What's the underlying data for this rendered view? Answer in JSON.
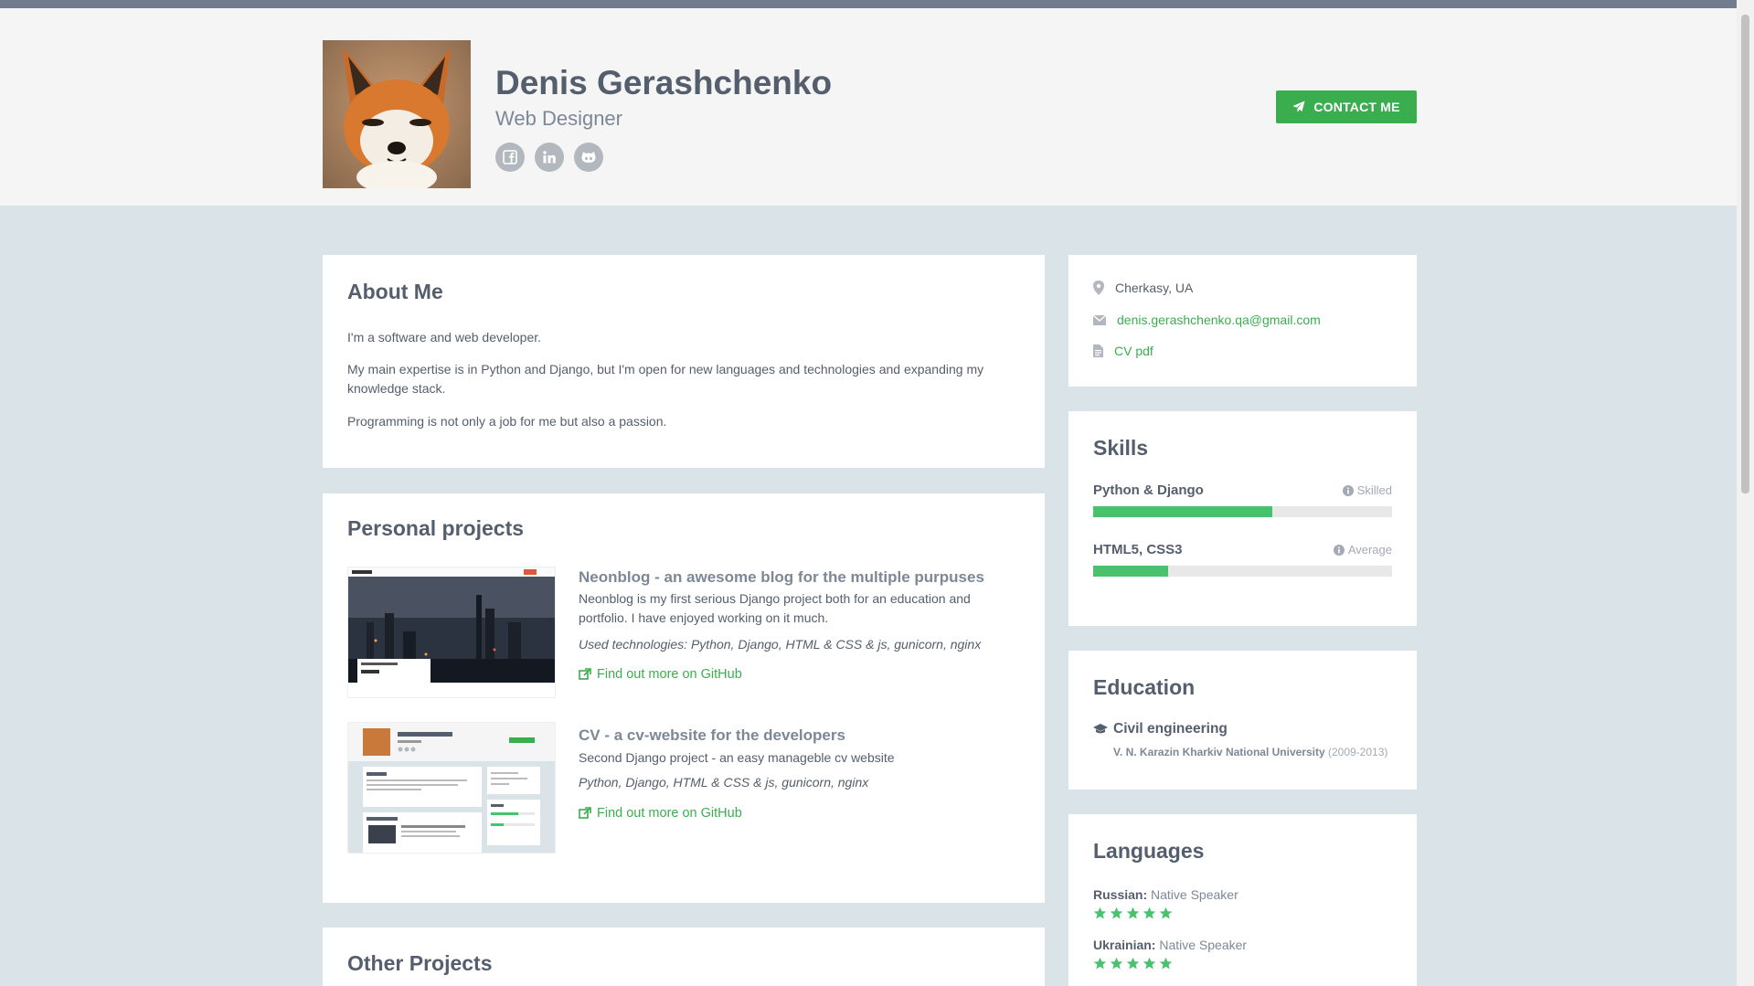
{
  "header": {
    "name": "Denis Gerashchenko",
    "tagline": "Web Designer",
    "avatar_alt": "fox avatar",
    "social": [
      "facebook-icon",
      "linkedin-icon",
      "github-icon"
    ],
    "contact_label": "CONTACT ME"
  },
  "about": {
    "title": "About Me",
    "paragraphs": [
      "I'm a software and web developer.",
      "My main expertise is in Python and Django, but I'm open for new languages and technologies and expanding my knowledge stack.",
      "Programming is not only a job for me but also a passion."
    ]
  },
  "projects": {
    "title": "Personal projects",
    "items": [
      {
        "title": "Neonblog - an awesome blog for the multiple purpuses",
        "description": "Neonblog is my first serious Django project both for an education and portfolio. I have enjoyed working on it much.",
        "tech": "Used technologies: Python, Django, HTML & CSS & js, gunicorn, nginx",
        "link": "Find out more on GitHub"
      },
      {
        "title": "CV - a cv-website for the developers",
        "description": "Second Django project - an easy manageble cv website",
        "tech": "Python, Django, HTML & CSS & js, gunicorn, nginx",
        "link": "Find out more on GitHub"
      }
    ]
  },
  "other_projects": {
    "title": "Other Projects"
  },
  "info": {
    "location": "Cherkasy, UA",
    "email": "denis.gerashchenko.qa@gmail.com",
    "cv": "CV pdf"
  },
  "skills": {
    "title": "Skills",
    "items": [
      {
        "name": "Python & Django",
        "level": "Skilled",
        "fraction": 0.6
      },
      {
        "name": "HTML5, CSS3",
        "level": "Average",
        "fraction": 0.25
      }
    ]
  },
  "education": {
    "title": "Education",
    "degree": "Civil engineering",
    "university": "V. N. Karazin Kharkiv National University",
    "years": "(2009-2013)"
  },
  "languages": {
    "title": "Languages",
    "items": [
      {
        "name": "Russian:",
        "level": "Native Speaker",
        "stars": 5
      },
      {
        "name": "Ukrainian:",
        "level": "Native Speaker",
        "stars": 5
      }
    ]
  },
  "colors": {
    "accent": "#3aae4e",
    "bar": "#49c26d",
    "star": "#49c26d",
    "page_bg": "#dae3e8",
    "header_bg": "#f5f5f5",
    "topbar": "#717d8e"
  }
}
